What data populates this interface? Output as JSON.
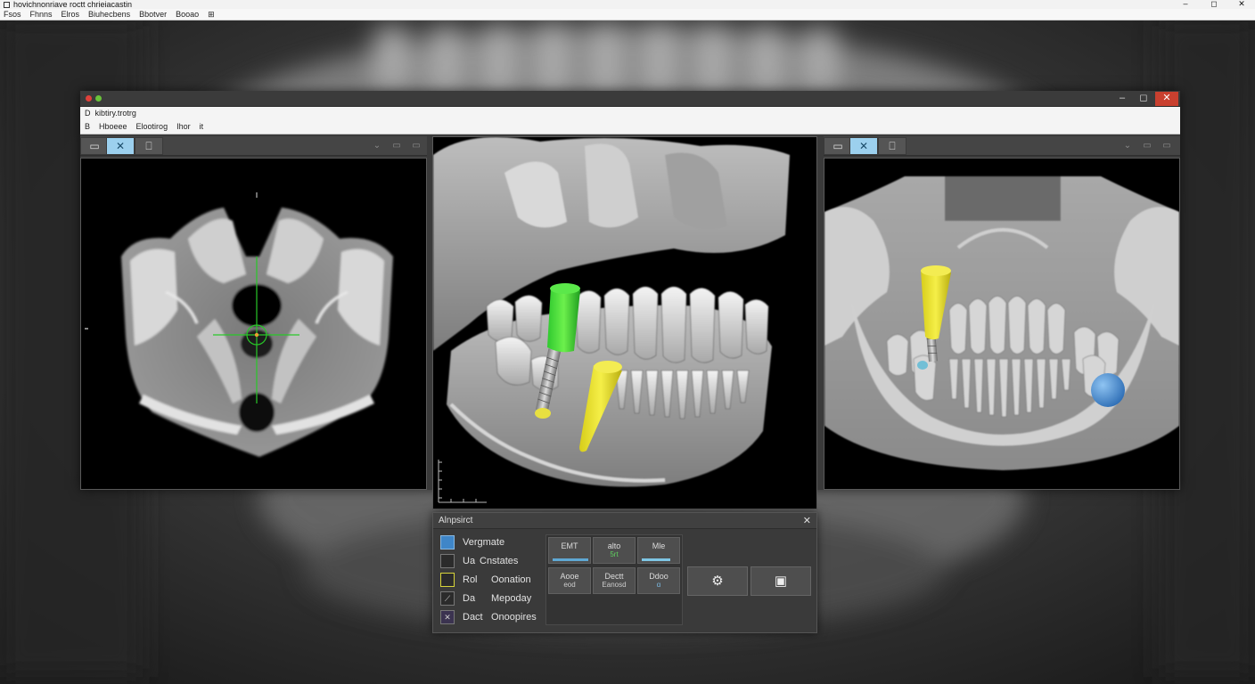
{
  "outer": {
    "title": "hovichnonriave roctt chrieiacastin",
    "menu": [
      "Fsos",
      "Fhnns",
      "Elros",
      "Biuhecbens",
      "Bbotver",
      "Booao"
    ],
    "menu_tail": "⊞",
    "controls": {
      "minimize": "–",
      "maximize": "◻",
      "close": "✕"
    }
  },
  "viewer": {
    "title": "kibtiry.trotrg",
    "title_prefix": "D",
    "menu": [
      "B",
      "Hboeee",
      "Elootirog",
      "Ihor",
      "it"
    ],
    "controls": {
      "minimize": "–",
      "maximize": "◻",
      "close": "✕"
    },
    "dot_colors": [
      "#e0413a",
      "#6ac23a"
    ]
  },
  "panes": [
    {
      "id": "axial",
      "toolbar": [
        "▭",
        "✕",
        "⎕"
      ],
      "active_tool": 1,
      "right_icons": [
        "⌄",
        "▭",
        "▭"
      ]
    },
    {
      "id": "3d"
    },
    {
      "id": "panoramic",
      "toolbar": [
        "▭",
        "✕",
        "⎕"
      ],
      "active_tool": 1,
      "right_icons": [
        "⌄",
        "▭",
        "▭"
      ]
    }
  ],
  "tool_panel": {
    "title": "Alnpsirct",
    "close": "✕",
    "layers": [
      {
        "label": "Vergmate",
        "label2": "",
        "swatch": "#3f86c8",
        "mark": ""
      },
      {
        "label": "Ua",
        "label2": "Cnstates",
        "swatch": "#2b2b2b",
        "mark": ""
      },
      {
        "label": "Rol",
        "label2": "Oonation",
        "swatch": "#2b2b2b",
        "mark": "",
        "border": "#d7d43a"
      },
      {
        "label": "Da",
        "label2": "Mepoday",
        "swatch": "#2b2b2b",
        "mark": "⟋"
      },
      {
        "label": "Dact",
        "label2": "Onoopires",
        "swatch": "#3b3350",
        "mark": "✕"
      }
    ],
    "cells": [
      {
        "l1": "EMT",
        "l2": "",
        "bar": 1.0
      },
      {
        "l1": "alto",
        "l2": "5rt",
        "bar": 0
      },
      {
        "l1": "Mle",
        "l2": "",
        "bar": 0.8
      },
      {
        "l1": "Aooe",
        "l2": "eod",
        "bar": 0
      },
      {
        "l1": "Dectt",
        "l2": "Eanosd",
        "bar": 0
      },
      {
        "l1": "Ddoo",
        "l2": "ɑ",
        "bar": 0
      }
    ],
    "actions": [
      {
        "icon": "⚙",
        "name": "settings-gear-icon"
      },
      {
        "icon": "▣",
        "name": "save-icon"
      }
    ]
  }
}
